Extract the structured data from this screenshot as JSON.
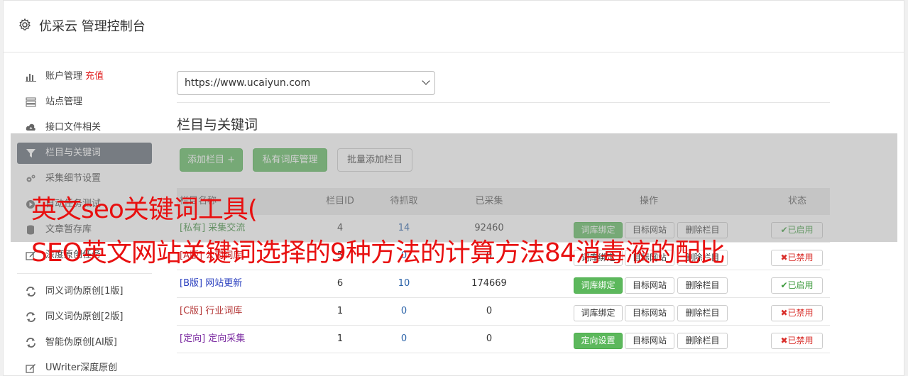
{
  "header": {
    "title": "优采云 管理控制台"
  },
  "sidebar": {
    "items": [
      {
        "label": "账户管理",
        "extra": "充值",
        "icon": "bar-chart-icon"
      },
      {
        "label": "站点管理",
        "icon": "server-icon"
      },
      {
        "label": "接口文件相关",
        "icon": "cloud-upload-icon"
      },
      {
        "label": "栏目与关键词",
        "icon": "filter-icon",
        "active": true
      },
      {
        "label": "采集细节设置",
        "icon": "cogs-icon"
      },
      {
        "label": "自动任务测试",
        "icon": "play-circle-icon"
      },
      {
        "label": "文章暂存库",
        "icon": "database-icon"
      },
      {
        "label": "深度原创任务",
        "icon": "edit-icon"
      }
    ],
    "items2": [
      {
        "label": "同义词伪原创[1版]",
        "icon": "refresh-icon"
      },
      {
        "label": "同义词伪原创[2版]",
        "icon": "refresh-icon"
      },
      {
        "label": "智能伪原创[AI版]",
        "icon": "refresh-icon"
      },
      {
        "label": "UWriter深度原创",
        "icon": "edit-icon"
      }
    ]
  },
  "site_select": {
    "value": "https://www.ucaiyun.com"
  },
  "section": {
    "title": "栏目与关键词"
  },
  "toolbar": {
    "add_column": "添加栏目 +",
    "private_lib": "私有词库管理",
    "batch_add": "批量添加栏目"
  },
  "table": {
    "headers": {
      "name": "栏目名称",
      "id": "栏目ID",
      "queue": "待抓取",
      "done": "已采集",
      "ops": "操作",
      "status": "状态"
    },
    "rows": [
      {
        "tag": "[私有]",
        "name": "采集交流",
        "id": "4",
        "queue": "14",
        "done": "92460",
        "op1": "词库绑定",
        "op2": "目标网站",
        "op3": "删除栏目",
        "status": "已启用",
        "on": true,
        "color": "#3c8d3c"
      },
      {
        "tag": "[A版]",
        "name": "公司词库",
        "id": "5",
        "queue": "0",
        "done": "0",
        "op1": "词库绑定",
        "op2": "目标网站",
        "op3": "删除栏目",
        "status": "已禁用",
        "on": false,
        "color": "#c03030"
      },
      {
        "tag": "[B版]",
        "name": "网站更新",
        "id": "6",
        "queue": "10",
        "done": "174669",
        "op1": "词库绑定",
        "op2": "目标网站",
        "op3": "删除栏目",
        "status": "已启用",
        "on": true,
        "color": "#2a3fbf"
      },
      {
        "tag": "[C版]",
        "name": "行业词库",
        "id": "1",
        "queue": "0",
        "done": "0",
        "op1": "词库绑定",
        "op2": "目标网站",
        "op3": "删除栏目",
        "status": "已禁用",
        "on": false,
        "color": "#b53a3a"
      },
      {
        "tag": "[定向]",
        "name": "定向采集",
        "id": "1",
        "queue": "0",
        "done": "0",
        "op1": "定向设置",
        "op2": "目标网站",
        "op3": "删除栏目",
        "status": "已禁用",
        "on": false,
        "color": "#7a2aa0"
      }
    ]
  },
  "overlay_text": {
    "line1": "英文seo关键词工具(",
    "line2": "SEO英文网站关键词选择的9种方法的计算方法84消毒液的配比"
  },
  "colors": {
    "accent_green": "#5cb85c",
    "active_nav": "#5d6671",
    "overlay_red": "#e81010"
  }
}
